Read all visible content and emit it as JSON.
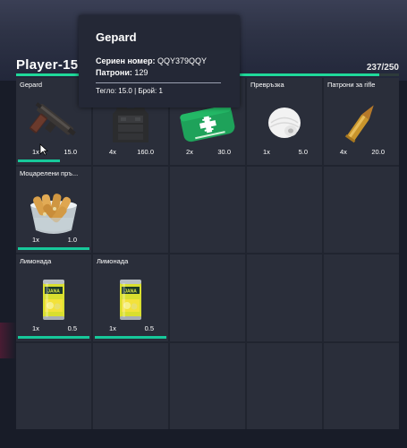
{
  "header": {
    "player_name": "Player-15",
    "weight_text": "237/250",
    "weight_fraction": 0.948,
    "accent_color": "#1fd99a"
  },
  "tooltip": {
    "title": "Gepard",
    "serial_label": "Сериен номер:",
    "serial_value": "QQY379QQY",
    "ammo_label": "Патрони:",
    "ammo_value": "129",
    "footer": "Тегло: 15.0 | Брой: 1"
  },
  "slots": [
    {
      "name": "Gepard",
      "qty": "1x",
      "weight": "15.0",
      "icon": "pistol-icon"
    },
    {
      "name": "",
      "qty": "4x",
      "weight": "160.0",
      "icon": "armor-vest-icon"
    },
    {
      "name": "",
      "qty": "2x",
      "weight": "30.0",
      "icon": "medkit-icon"
    },
    {
      "name": "Превръзка",
      "qty": "1x",
      "weight": "5.0",
      "icon": "bandage-icon"
    },
    {
      "name": "Патрони за rifle",
      "qty": "4x",
      "weight": "20.0",
      "icon": "bullet-icon"
    },
    {
      "name": "Моцарелени пръ...",
      "qty": "1x",
      "weight": "1.0",
      "icon": "mozzarella-sticks-icon"
    },
    {
      "name": "Лимонада",
      "qty": "1x",
      "weight": "0.5",
      "icon": "lemonade-can-icon"
    },
    {
      "name": "Лимонада",
      "qty": "1x",
      "weight": "0.5",
      "icon": "lemonade-can-icon"
    }
  ]
}
